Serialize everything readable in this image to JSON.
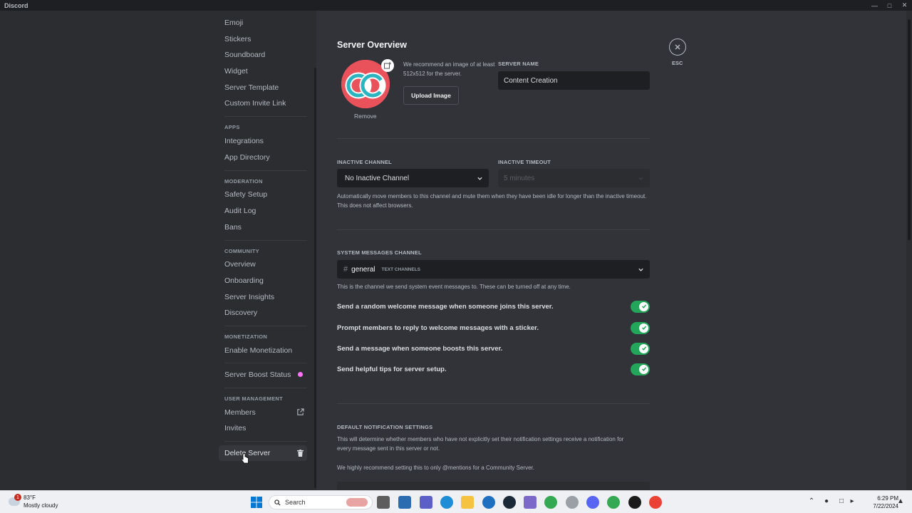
{
  "window": {
    "title": "Discord"
  },
  "sidebar": {
    "items_top": [
      {
        "label": "Emoji"
      },
      {
        "label": "Stickers"
      },
      {
        "label": "Soundboard"
      },
      {
        "label": "Widget"
      },
      {
        "label": "Server Template"
      },
      {
        "label": "Custom Invite Link"
      }
    ],
    "apps": {
      "heading": "APPS",
      "items": [
        {
          "label": "Integrations"
        },
        {
          "label": "App Directory"
        }
      ]
    },
    "moderation": {
      "heading": "MODERATION",
      "items": [
        {
          "label": "Safety Setup"
        },
        {
          "label": "Audit Log"
        },
        {
          "label": "Bans"
        }
      ]
    },
    "community": {
      "heading": "COMMUNITY",
      "items": [
        {
          "label": "Overview"
        },
        {
          "label": "Onboarding"
        },
        {
          "label": "Server Insights"
        },
        {
          "label": "Discovery"
        }
      ]
    },
    "monetization": {
      "heading": "MONETIZATION",
      "items": [
        {
          "label": "Enable Monetization"
        }
      ]
    },
    "boost": {
      "label": "Server Boost Status",
      "gem_color": "#ff73fa"
    },
    "user_management": {
      "heading": "USER MANAGEMENT",
      "items": [
        {
          "label": "Members"
        },
        {
          "label": "Invites"
        }
      ]
    },
    "delete": {
      "label": "Delete Server"
    }
  },
  "main": {
    "title": "Server Overview",
    "icon": {
      "initials": "CC",
      "remove_label": "Remove"
    },
    "recommend_text": "We recommend an image of at least 512x512 for the server.",
    "upload_label": "Upload Image",
    "server_name": {
      "label": "SERVER NAME",
      "value": "Content Creation"
    },
    "inactive_channel": {
      "label": "INACTIVE CHANNEL",
      "value": "No Inactive Channel"
    },
    "inactive_timeout": {
      "label": "INACTIVE TIMEOUT",
      "value": "5 minutes"
    },
    "inactive_help": "Automatically move members to this channel and mute them when they have been idle for longer than the inactive timeout. This does not affect browsers.",
    "system_channel": {
      "label": "SYSTEM MESSAGES CHANNEL",
      "channel": "general",
      "category": "TEXT CHANNELS",
      "help": "This is the channel we send system event messages to. These can be turned off at any time."
    },
    "toggles": [
      {
        "label": "Send a random welcome message when someone joins this server.",
        "on": true
      },
      {
        "label": "Prompt members to reply to welcome messages with a sticker.",
        "on": true
      },
      {
        "label": "Send a message when someone boosts this server.",
        "on": true
      },
      {
        "label": "Send helpful tips for server setup.",
        "on": true
      }
    ],
    "notifications": {
      "label": "DEFAULT NOTIFICATION SETTINGS",
      "help": "This will determine whether members who have not explicitly set their notification settings receive a notification for every message sent in this server or not.",
      "recommend": "We highly recommend setting this to only @mentions for a Community Server."
    },
    "close_label": "ESC"
  },
  "taskbar": {
    "weather_temp": "83°F",
    "weather_cond": "Mostly cloudy",
    "weather_badge": "1",
    "search_placeholder": "Search",
    "time": "6:29 PM",
    "date": "7/22/2024"
  },
  "colors": {
    "accent_green": "#23a55a",
    "bg_main": "#313338",
    "bg_sidebar": "#2b2d31"
  }
}
